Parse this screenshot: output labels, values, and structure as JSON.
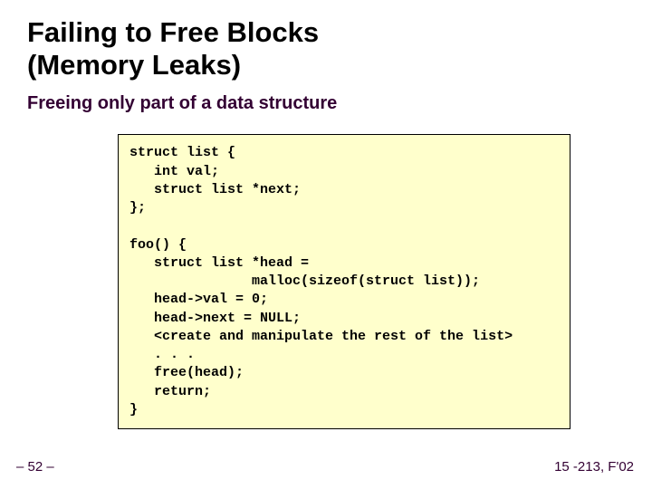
{
  "slide": {
    "title": "Failing to Free Blocks\n(Memory Leaks)",
    "subtitle": "Freeing only part of a data structure",
    "code": "struct list {\n   int val;\n   struct list *next;\n};\n\nfoo() {\n   struct list *head =\n               malloc(sizeof(struct list));\n   head->val = 0;\n   head->next = NULL;\n   <create and manipulate the rest of the list>\n   . . .\n   free(head);\n   return;\n}"
  },
  "footer": {
    "left": "– 52 –",
    "right": "15 -213, F'02"
  }
}
